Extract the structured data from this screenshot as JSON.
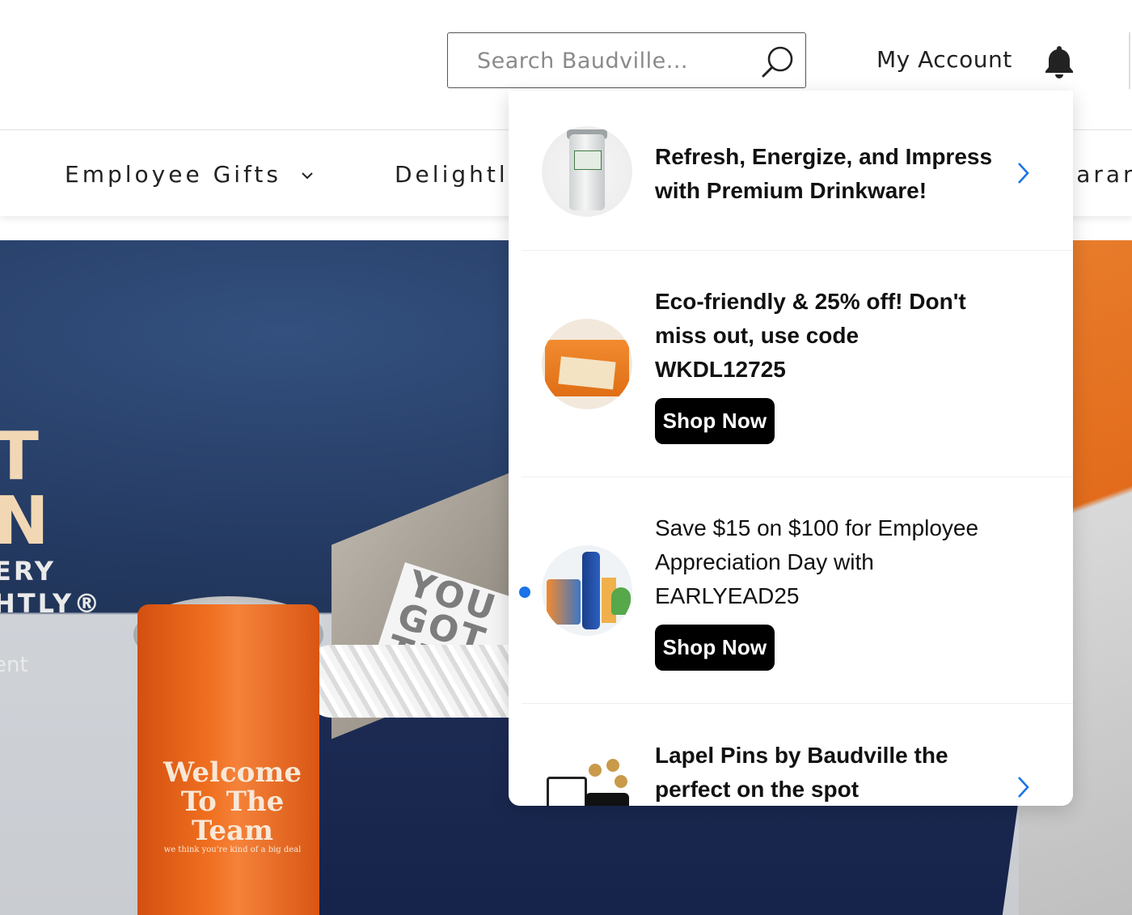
{
  "header": {
    "search_placeholder": "Search Baudville...",
    "account_label": "My Account"
  },
  "nav": {
    "items": [
      {
        "label": "Employee Gifts"
      },
      {
        "label": "Delightl"
      },
      {
        "label": "earar"
      }
    ]
  },
  "hero": {
    "line1": "T",
    "line2": "N",
    "line3": "ERY",
    "line4": "HTLY®",
    "line5": "ent",
    "book_text": "YOU\nGOT\nTHIS",
    "tumbler_text": "Welcome To The Team",
    "tumbler_small": "we think you're kind of a big deal"
  },
  "notifications": [
    {
      "title": "Refresh, Energize, and Impress with Premium Drinkware!",
      "bold": true,
      "has_arrow": true,
      "unread": false,
      "thumbnail_icon": "drinkware-thumbnail"
    },
    {
      "title": "Eco-friendly & 25% off! Don't miss out, use code WKDL12725",
      "bold": true,
      "button_label": "Shop Now",
      "unread": false,
      "thumbnail_icon": "teamwork-bag-thumbnail"
    },
    {
      "title": "Save $15 on $100 for Employee Appreciation Day with EARLYEAD25",
      "bold": false,
      "button_label": "Shop Now",
      "unread": true,
      "thumbnail_icon": "appreciation-kit-thumbnail"
    },
    {
      "title": "Lapel Pins by Baudville the perfect on the spot",
      "bold": true,
      "has_arrow": true,
      "unread": false,
      "thumbnail_icon": "lapel-pins-thumbnail"
    }
  ],
  "colors": {
    "unread_dot": "#1a73e8",
    "arrow": "#1a73e8",
    "button_bg": "#000000",
    "button_text": "#ffffff"
  }
}
